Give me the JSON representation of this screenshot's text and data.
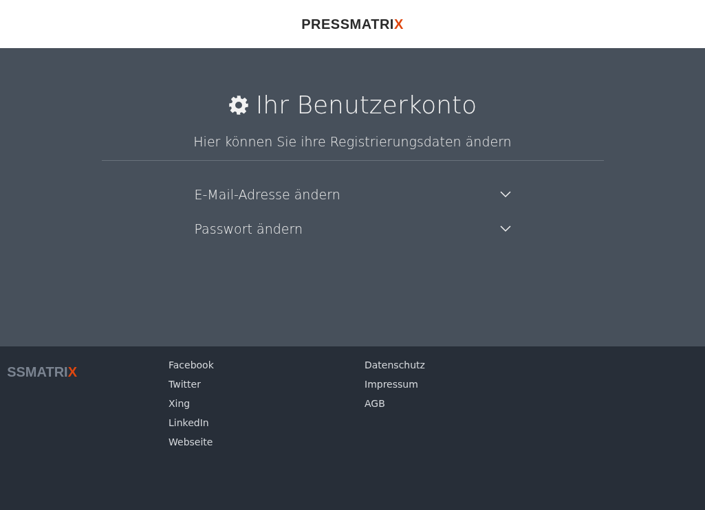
{
  "header": {
    "logo": {
      "text": "PRESSMATRI",
      "accent": "X"
    }
  },
  "account": {
    "title": "Ihr Benutzerkonto",
    "subtitle": "Hier können Sie ihre Registrierungsdaten ändern",
    "sections": [
      {
        "label": "E-Mail-Adresse ändern",
        "expanded": false
      },
      {
        "label": "Passwort ändern",
        "expanded": false
      }
    ]
  },
  "footer": {
    "logo": {
      "text": "SSMATRI",
      "accent": "X"
    },
    "social_links": [
      "Facebook",
      "Twitter",
      "Xing",
      "LinkedIn",
      "Webseite"
    ],
    "legal_links": [
      "Datenschutz",
      "Impressum",
      "AGB"
    ]
  }
}
